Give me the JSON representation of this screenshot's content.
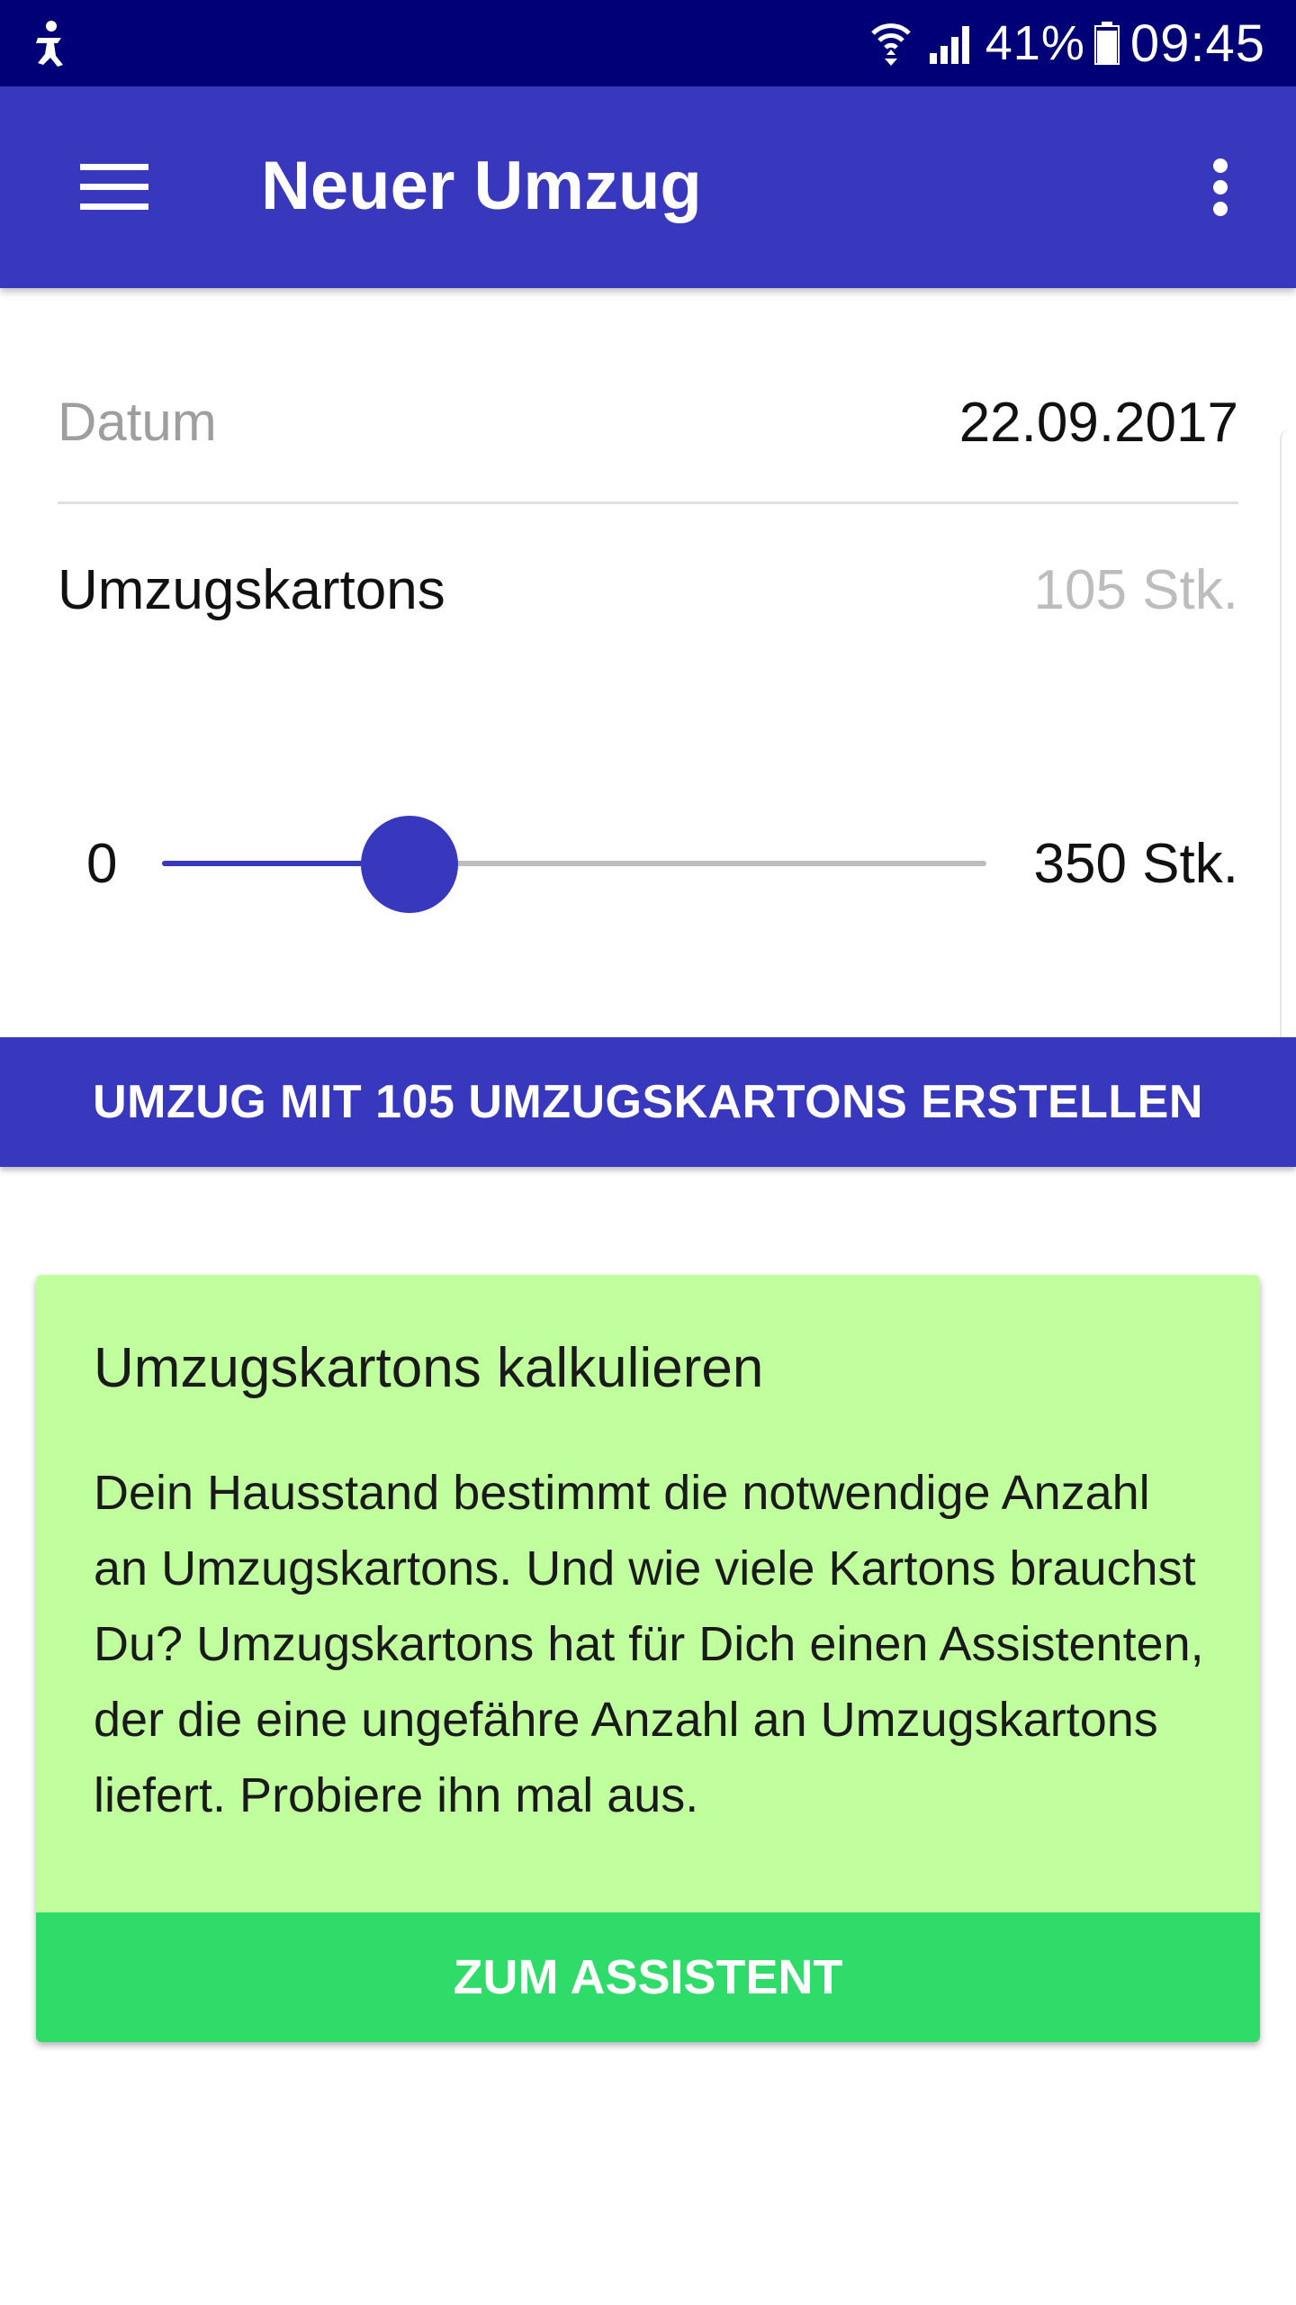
{
  "status_bar": {
    "battery_percent": "41%",
    "time": "09:45"
  },
  "app_bar": {
    "title": "Neuer Umzug"
  },
  "form": {
    "date_label": "Datum",
    "date_value": "22.09.2017",
    "boxes_label": "Umzugskartons",
    "boxes_value": "105 Stk.",
    "slider": {
      "min_label": "0",
      "max_label": "350 Stk.",
      "value": 105,
      "max": 350
    },
    "create_button": "UMZUG MIT 105 UMZUGSKARTONS ERSTELLEN"
  },
  "card": {
    "title": "Umzugskartons kalkulieren",
    "text": "Dein Hausstand bestimmt die notwendige Anzahl an Umzugskartons. Und wie viele Kartons brauchst Du? Umzugskartons hat für Dich einen Assistenten, der die eine ungefähre Anzahl an Umzugskartons liefert. Probiere ihn mal aus.",
    "button": "ZUM ASSISTENT"
  },
  "icons": {
    "status_left": "accessibility-icon",
    "wifi": "wifi-icon",
    "signal": "signal-icon",
    "battery": "battery-icon",
    "menu": "menu-icon",
    "overflow": "more-vert-icon"
  },
  "colors": {
    "status_bar": "#020077",
    "primary": "#3838bf",
    "card_bg": "#c1fe9e",
    "card_button": "#2fdc6a"
  }
}
